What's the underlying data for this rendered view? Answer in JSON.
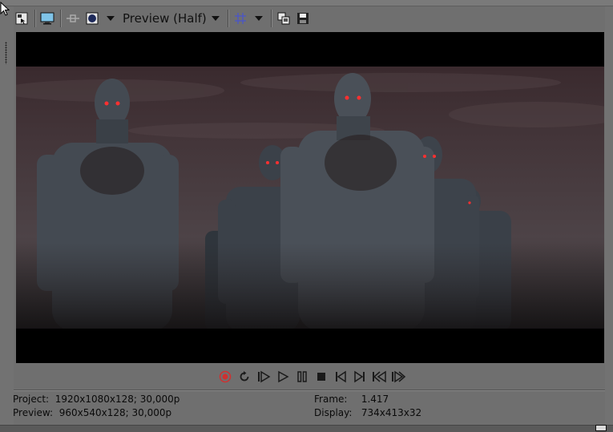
{
  "toolbar": {
    "preview_quality": "Preview (Half)"
  },
  "status": {
    "project_label": "Project:",
    "project_value": "1920x1080x128; 30,000p",
    "preview_label": "Preview:",
    "preview_value": "960x540x128; 30,000p",
    "frame_label": "Frame:",
    "frame_value": "1.417",
    "display_label": "Display:",
    "display_value": "734x413x32"
  },
  "icons": {
    "toolbar": [
      "project-properties-icon",
      "external-monitor-icon",
      "split-screen-icon",
      "video-fx-icon",
      "preview-quality-dropdown",
      "overlays-icon",
      "copy-snapshot-icon",
      "save-snapshot-icon"
    ],
    "transport": [
      "record-icon",
      "loop-icon",
      "play-from-start-icon",
      "play-icon",
      "pause-icon",
      "stop-icon",
      "go-to-start-icon",
      "go-to-end-icon",
      "previous-frame-icon",
      "next-frame-icon"
    ]
  },
  "colors": {
    "background": "#6f6f6f",
    "record": "#d03030",
    "grid_icon": "#4a56c8"
  }
}
